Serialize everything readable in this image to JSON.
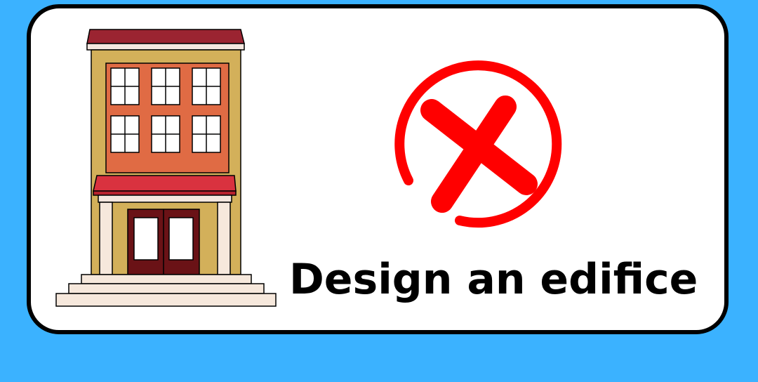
{
  "caption": {
    "text": "Design an edifice"
  },
  "icons": {
    "building": "building-illustration",
    "mark": "red-x-in-circle"
  },
  "colors": {
    "background": "#3bb2ff",
    "card": "#ffffff",
    "border": "#000000",
    "cross": "#ff0000",
    "roof": "#9b2431",
    "facade": "#e06b44",
    "wall": "#d3b05a",
    "awning": "#d9323f",
    "door": "#6a1216",
    "steps": "#f6e8dc"
  }
}
